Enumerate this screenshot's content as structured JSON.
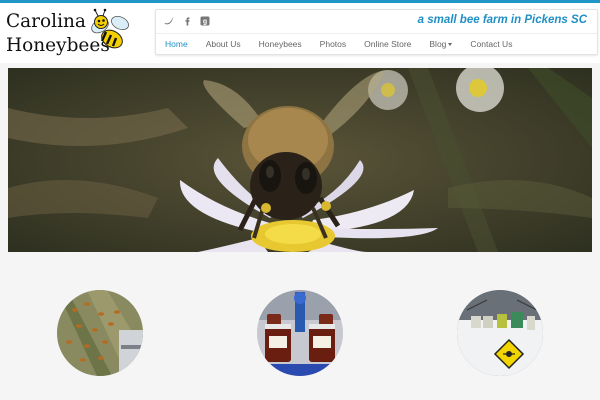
{
  "brand": {
    "line1": "Carolina",
    "line2": "Honeybees"
  },
  "tagline": "a small bee farm in Pickens SC",
  "social": [
    {
      "icon": "twitter-icon",
      "glyph": "𝕥"
    },
    {
      "icon": "facebook-icon",
      "glyph": "f"
    },
    {
      "icon": "google-plus-icon",
      "glyph": "g"
    }
  ],
  "nav": {
    "home": "Home",
    "about": "About Us",
    "honeybees": "Honeybees",
    "photos": "Photos",
    "store": "Online Store",
    "blog": "Blog",
    "contact": "Contact Us"
  },
  "colors": {
    "accent": "#1f8fc4",
    "topbar": "#2196c7",
    "background": "#f5f5f5"
  },
  "features": [
    {
      "icon": "bees-photo"
    },
    {
      "icon": "honey-jars-photo"
    },
    {
      "icon": "beehives-photo"
    }
  ]
}
